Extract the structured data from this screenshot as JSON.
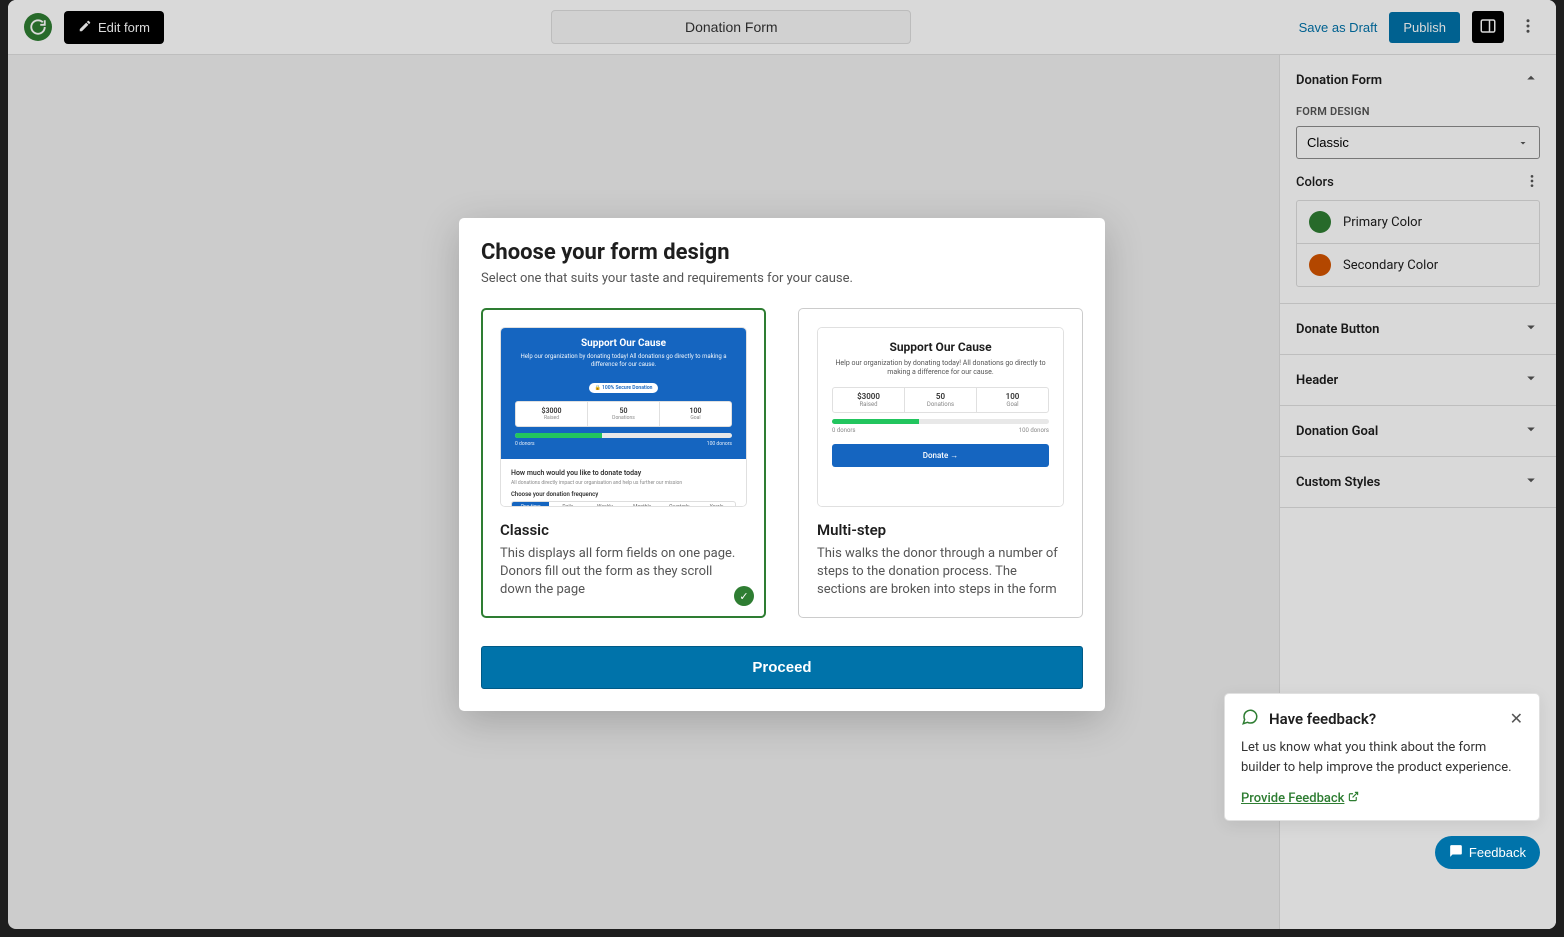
{
  "header": {
    "editFormLabel": "Edit form",
    "title": "Donation Form",
    "saveDraft": "Save as Draft",
    "publish": "Publish"
  },
  "sidebar": {
    "mainPanelTitle": "Donation Form",
    "formDesignLabel": "FORM DESIGN",
    "formDesignValue": "Classic",
    "colorsLabel": "Colors",
    "colors": {
      "primary": {
        "label": "Primary Color",
        "hex": "#2e7d32"
      },
      "secondary": {
        "label": "Secondary Color",
        "hex": "#d35400"
      }
    },
    "sections": {
      "donateButton": "Donate Button",
      "headerSection": "Header",
      "donationGoal": "Donation Goal",
      "customStyles": "Custom Styles"
    }
  },
  "modal": {
    "title": "Choose your form design",
    "subtitle": "Select one that suits your taste and requirements for your cause.",
    "classic": {
      "label": "Classic",
      "desc": "This displays all form fields on one page. Donors fill out the form as they scroll down the page",
      "preview": {
        "heading": "Support Our Cause",
        "sub": "Help our organization by donating today! All donations go directly to making a difference for our cause.",
        "secure": "🔒 100% Secure Donation",
        "raisedVal": "$3000",
        "raisedLbl": "Raised",
        "donationsVal": "50",
        "donationsLbl": "Donations",
        "goalVal": "100",
        "goalLbl": "Goal",
        "p0": "0 donors",
        "p1": "100 donors",
        "q1": "How much would you like to donate today",
        "q1sub": "All donations directly impact our organisation and help us further our mission",
        "freqLabel": "Choose your donation frequency",
        "freq": [
          "One time",
          "Daily",
          "Weekly",
          "Monthly",
          "Quarterly",
          "Yearly"
        ]
      }
    },
    "multistep": {
      "label": "Multi-step",
      "desc": "This walks the donor through a number of steps to the donation process. The sections are broken into steps in the form",
      "preview": {
        "heading": "Support Our Cause",
        "sub": "Help our organization by donating today! All donations go directly to making a difference for our cause.",
        "raisedVal": "$3000",
        "raisedLbl": "Raised",
        "donationsVal": "50",
        "donationsLbl": "Donations",
        "goalVal": "100",
        "goalLbl": "Goal",
        "p0": "0 donors",
        "p1": "100 donors",
        "donateBtn": "Donate  →"
      }
    },
    "proceed": "Proceed"
  },
  "feedback": {
    "title": "Have feedback?",
    "body": "Let us know what you think about the form builder to help improve the product experience.",
    "link": "Provide Feedback",
    "fab": "Feedback"
  }
}
